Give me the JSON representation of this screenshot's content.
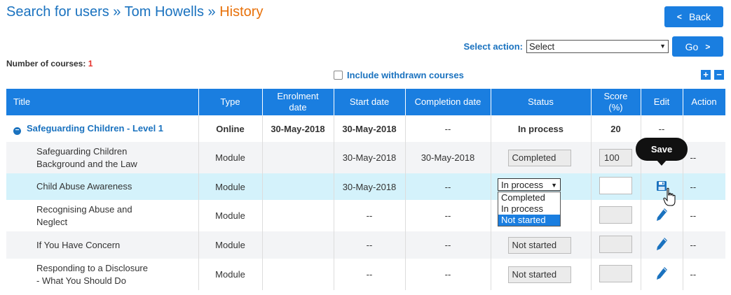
{
  "breadcrumb": {
    "part1": "Search for users",
    "sep1": " » ",
    "part2": "Tom Howells",
    "sep2": " » ",
    "current": "History"
  },
  "back_button": {
    "label": "Back"
  },
  "go_button": {
    "label": "Go"
  },
  "select_action": {
    "label": "Select action:",
    "value": "Select"
  },
  "course_count": {
    "label": "Number of courses:",
    "value": "1"
  },
  "include_withdrawn": {
    "label": "Include withdrawn courses",
    "checked": false
  },
  "expand_controls": {
    "plus": "+",
    "minus": "−"
  },
  "table": {
    "headers": {
      "title": "Title",
      "type": "Type",
      "enrolment_1": "Enrolment",
      "enrolment_2": "date",
      "start": "Start date",
      "completion": "Completion date",
      "status": "Status",
      "score_1": "Score",
      "score_2": "(%)",
      "edit": "Edit",
      "action": "Action"
    },
    "course": {
      "title": "Safeguarding Children - Level 1",
      "type": "Online",
      "enrolment": "30-May-2018",
      "start": "30-May-2018",
      "completion": "--",
      "status": "In process",
      "score": "20",
      "edit": "--",
      "action": ""
    },
    "modules": [
      {
        "title_1": "Safeguarding Children",
        "title_2": "Background and the Law",
        "type": "Module",
        "enrolment": "",
        "start": "30-May-2018",
        "completion": "30-May-2018",
        "status": "Completed",
        "score": "100",
        "action": "--"
      },
      {
        "title_1": "Child Abuse Awareness",
        "title_2": "",
        "type": "Module",
        "enrolment": "",
        "start": "30-May-2018",
        "completion": "--",
        "status": "In process",
        "score": "",
        "action": "--"
      },
      {
        "title_1": "Recognising Abuse and",
        "title_2": "Neglect",
        "type": "Module",
        "enrolment": "",
        "start": "--",
        "completion": "--",
        "status": "Not started",
        "score": "",
        "action": "--"
      },
      {
        "title_1": "If You Have Concern",
        "title_2": "",
        "type": "Module",
        "enrolment": "",
        "start": "--",
        "completion": "--",
        "status": "Not started",
        "score": "",
        "action": "--"
      },
      {
        "title_1": "Responding to a Disclosure",
        "title_2": "- What You Should Do",
        "type": "Module",
        "enrolment": "",
        "start": "--",
        "completion": "--",
        "status": "Not started",
        "score": "",
        "action": "--"
      }
    ]
  },
  "status_dropdown": {
    "selected": "In process",
    "options": [
      "Completed",
      "In process",
      "Not started"
    ],
    "highlighted": "Not started"
  },
  "tooltip": {
    "text": "Save"
  },
  "icons": {
    "edit": "pencil-icon",
    "save": "floppy-disk-icon",
    "cursor": "hand-pointer-icon",
    "collapse": "minus-circle-icon"
  },
  "colors": {
    "accent": "#1a7ee0",
    "link": "#1a72bf",
    "current_crumb": "#e8710a",
    "count": "#e5302a",
    "highlight_row": "#d4f2fb"
  }
}
